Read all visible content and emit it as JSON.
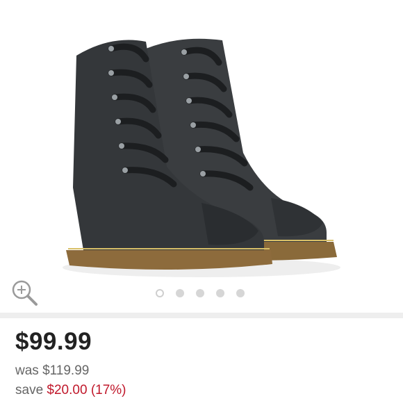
{
  "product": {
    "image_alt": "black lace-up combat boots with ribbon laces"
  },
  "gallery": {
    "zoom_icon": "zoom-in-icon",
    "dot_count": 5,
    "active_index": 0
  },
  "pricing": {
    "current_price": "$99.99",
    "was_label": "was",
    "was_price": "$119.99",
    "save_label": "save",
    "save_amount": "$20.00",
    "save_percent": "(17%)"
  },
  "colors": {
    "accent_red": "#c0182b",
    "divider": "#eeeeee"
  }
}
